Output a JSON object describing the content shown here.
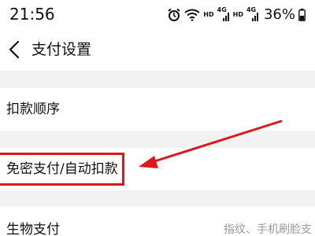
{
  "status_bar": {
    "time": "21:56",
    "net1_label": "HD",
    "net1_gen": "4G",
    "net2_label": "HD",
    "net2_gen": "4G",
    "battery": "36%"
  },
  "header": {
    "title": "支付设置"
  },
  "settings": {
    "deduct_order": "扣款顺序",
    "password_free": "免密支付/自动扣款",
    "biometric": "生物支付",
    "biometric_hint": "指纹、手机刷脸支"
  },
  "annotation": {
    "color": "#d9181f"
  }
}
